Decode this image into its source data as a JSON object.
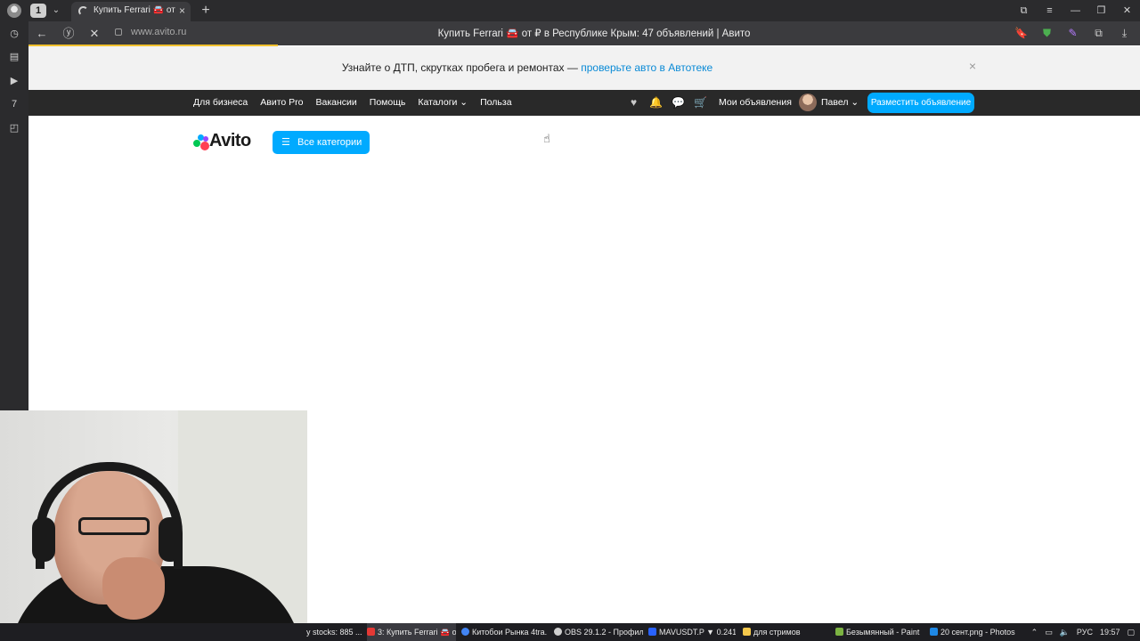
{
  "browser": {
    "tab_count": "1",
    "tab_title": "Купить Ferrari 🚘 от ₽ в",
    "url": "www.avito.ru",
    "page_title": "Купить Ferrari 🚘 от ₽ в Республике Крым: 47 объявлений | Авито"
  },
  "notice": {
    "text": "Узнайте о ДТП, скрутках пробега и ремонтах — ",
    "link": "проверьте авто в Автотеке",
    "close": "×"
  },
  "topnav": {
    "links": [
      "Для бизнеса",
      "Авито Pro",
      "Вакансии",
      "Помощь",
      "Каталоги ⌄",
      "Польза"
    ],
    "my_ads": "Мои объявления",
    "user_name": "Павел ⌄",
    "post_button": "Разместить объявление"
  },
  "header": {
    "logo_text": "Avito",
    "all_categories": "Все категории"
  },
  "taskbar": {
    "tasks": [
      "y stocks: 885 ...",
      "3: Купить Ferrari 🚘 о...",
      "Китобои Рынка 4tra...",
      "OBS 29.1.2 - Профил...",
      "MAVUSDT.P ▼ 0.241...",
      "для стримов",
      "Безымянный - Paint",
      "20 сент.png - Photos"
    ],
    "language": "РУС",
    "time": "19:57"
  },
  "colors": {
    "accent": "#00aaff",
    "link": "#0a8ad6",
    "nav_bg": "#292929",
    "progress": "#f2c12e"
  }
}
